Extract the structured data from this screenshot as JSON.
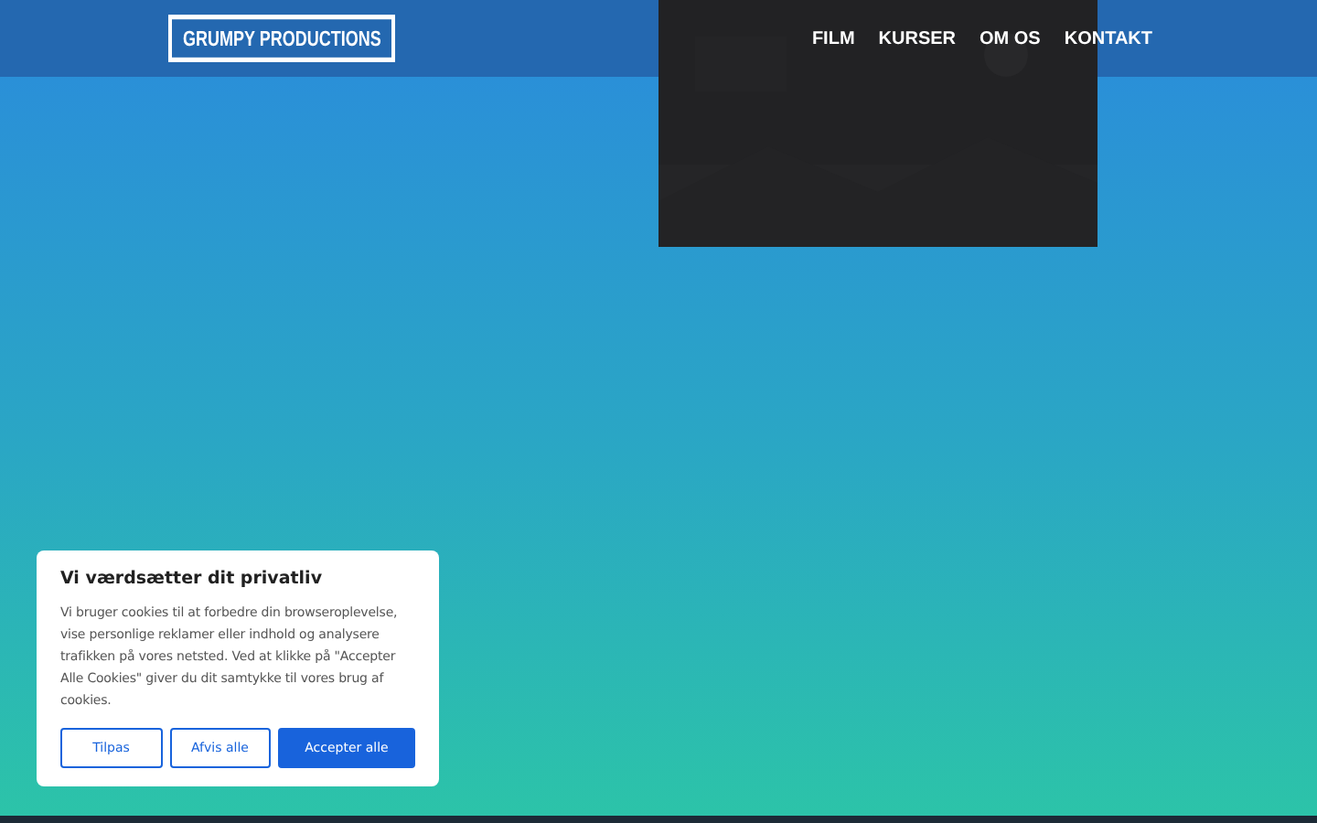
{
  "header": {
    "logo": "GRUMPY PRODUCTIONS",
    "nav": [
      {
        "label": "FILM"
      },
      {
        "label": "KURSER"
      },
      {
        "label": "OM OS"
      },
      {
        "label": "KONTAKT"
      }
    ]
  },
  "cookie_banner": {
    "title": "Vi værdsætter dit privatliv",
    "text": "Vi bruger cookies til at forbedre din browseroplevelse, vise personlige reklamer eller indhold og analysere trafikken på vores netsted. Ved at klikke på \"Accepter Alle Cookies\" giver du dit samtykke til vores brug af cookies.",
    "buttons": [
      {
        "label": "Tilpas",
        "kind": "outline"
      },
      {
        "label": "Afvis alle",
        "kind": "outline"
      },
      {
        "label": "Accepter alle",
        "kind": "primary"
      }
    ]
  }
}
